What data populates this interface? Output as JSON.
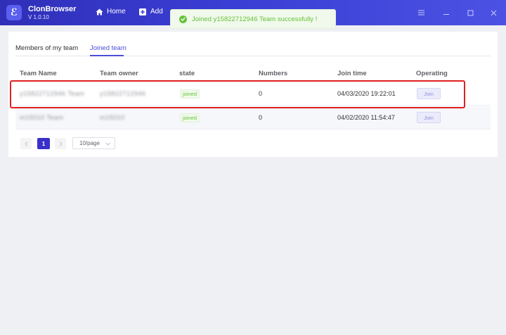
{
  "app": {
    "logo_glyph": "ℰ",
    "name": "ClonBrowser",
    "version": "V 1.0.10"
  },
  "nav": {
    "home_label": "Home",
    "add_label": "Add"
  },
  "toast": {
    "message": "Joined y15822712946 Team successfully !",
    "color": "#67c23a"
  },
  "tabs": [
    {
      "label": "Members of my team",
      "active": false
    },
    {
      "label": "Joined team",
      "active": true
    }
  ],
  "table": {
    "headers": [
      "Team Name",
      "Team owner",
      "state",
      "Numbers",
      "Join time",
      "Operating"
    ],
    "rows": [
      {
        "team_name": "y15822712946 Team",
        "owner": "y15822712946",
        "state": "joined",
        "numbers": "0",
        "join_time": "04/03/2020 19:22:01",
        "operating": "Join"
      },
      {
        "team_name": "m15010 Team",
        "owner": "m15010",
        "state": "joined",
        "numbers": "0",
        "join_time": "04/02/2020 11:54:47",
        "operating": "Join"
      }
    ]
  },
  "pagination": {
    "current_page": "1",
    "page_size": "10/page"
  },
  "colors": {
    "accent": "#4a4fd9",
    "titlebar": "#3a3ed4",
    "highlight": "#e02020"
  }
}
